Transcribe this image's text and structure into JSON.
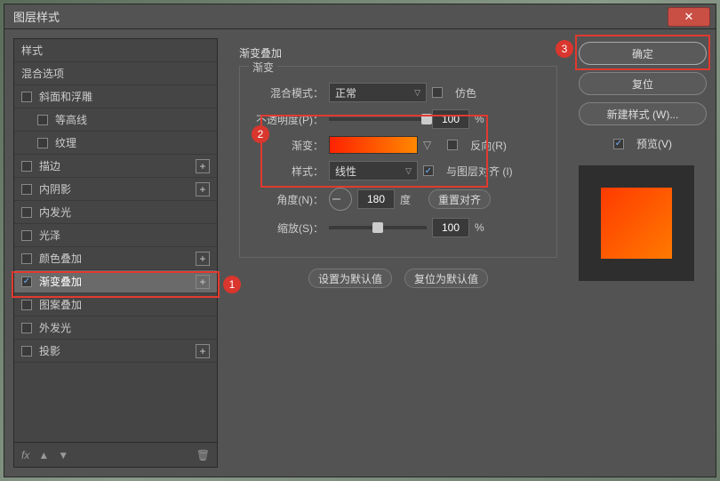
{
  "window": {
    "title": "图层样式"
  },
  "sidebar": {
    "header_styles": "样式",
    "header_blend": "混合选项",
    "items": [
      {
        "label": "斜面和浮雕",
        "checked": false,
        "plus": false,
        "indent": false
      },
      {
        "label": "等高线",
        "checked": false,
        "plus": false,
        "indent": true
      },
      {
        "label": "纹理",
        "checked": false,
        "plus": false,
        "indent": true
      },
      {
        "label": "描边",
        "checked": false,
        "plus": true,
        "indent": false
      },
      {
        "label": "内阴影",
        "checked": false,
        "plus": true,
        "indent": false
      },
      {
        "label": "内发光",
        "checked": false,
        "plus": false,
        "indent": false
      },
      {
        "label": "光泽",
        "checked": false,
        "plus": false,
        "indent": false
      },
      {
        "label": "颜色叠加",
        "checked": false,
        "plus": true,
        "indent": false
      },
      {
        "label": "渐变叠加",
        "checked": true,
        "plus": true,
        "indent": false,
        "selected": true
      },
      {
        "label": "图案叠加",
        "checked": false,
        "plus": false,
        "indent": false
      },
      {
        "label": "外发光",
        "checked": false,
        "plus": false,
        "indent": false
      },
      {
        "label": "投影",
        "checked": false,
        "plus": true,
        "indent": false
      }
    ],
    "footer_fx": "fx"
  },
  "center": {
    "section_title": "渐变叠加",
    "fieldset_legend": "渐变",
    "blend_mode_label": "混合模式：",
    "blend_mode_value": "正常",
    "dither_label": "仿色",
    "opacity_label": "不透明度(P)：",
    "opacity_value": "100",
    "percent": "%",
    "gradient_label": "渐变：",
    "reverse_label": "反向(R)",
    "style_label": "样式：",
    "style_value": "线性",
    "align_label": "与图层对齐 (I)",
    "angle_label": "角度(N)：",
    "angle_value": "180",
    "angle_unit": "度",
    "reset_align": "重置对齐",
    "scale_label": "缩放(S)：",
    "scale_value": "100",
    "set_default": "设置为默认值",
    "reset_default": "复位为默认值"
  },
  "right": {
    "ok": "确定",
    "reset": "复位",
    "new_style": "新建样式 (W)...",
    "preview_label": "预览(V)"
  },
  "callouts": {
    "one": "1",
    "two": "2",
    "three": "3"
  }
}
